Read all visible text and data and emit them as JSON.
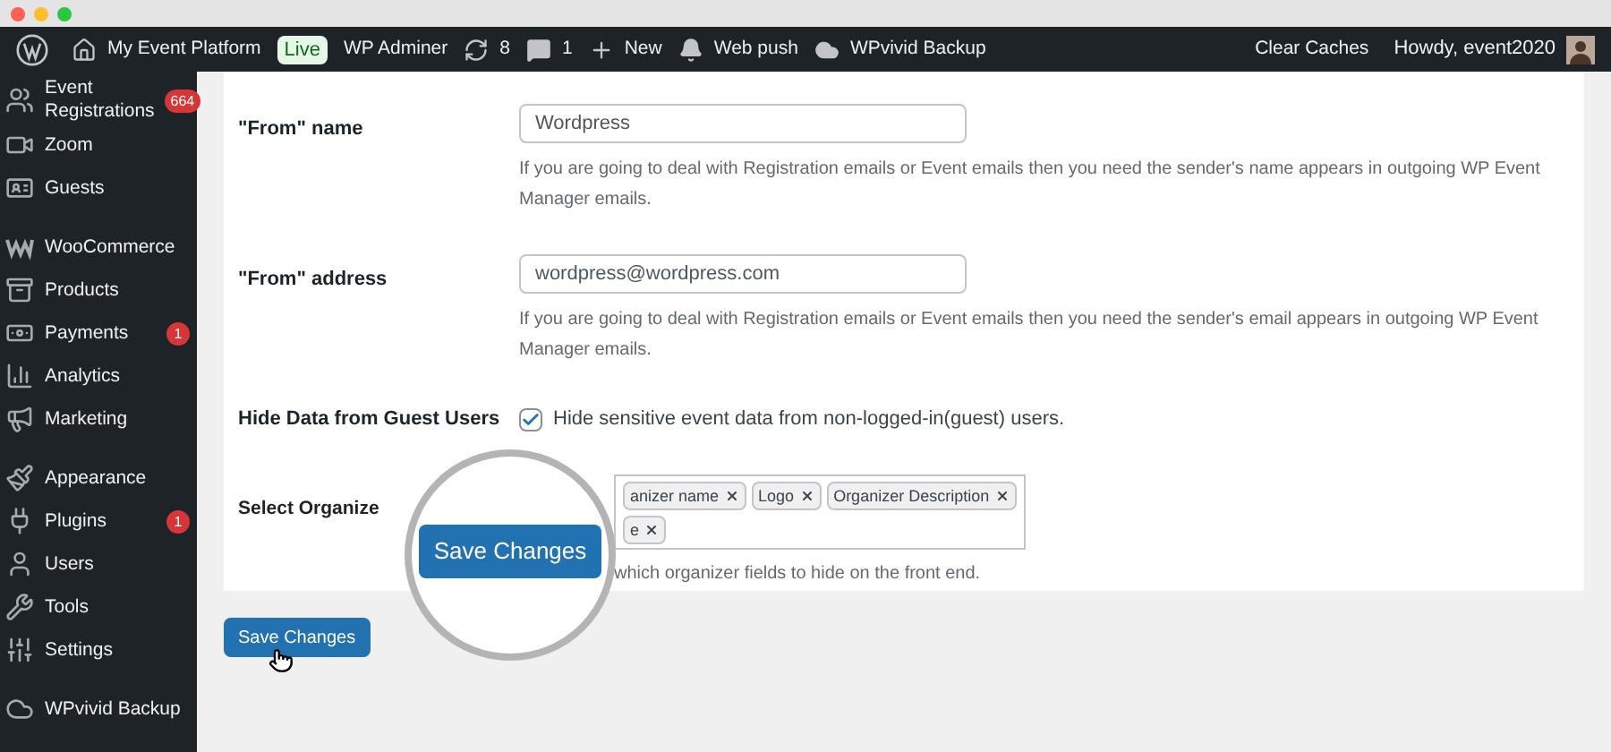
{
  "window_controls": [
    {
      "color": "#ff5f57"
    },
    {
      "color": "#febc2e"
    },
    {
      "color": "#28c840"
    }
  ],
  "admin_bar": {
    "left": [
      {
        "kind": "logo"
      },
      {
        "kind": "site",
        "label": "My Event Platform"
      },
      {
        "kind": "badge",
        "label": "Live"
      },
      {
        "kind": "text",
        "label": "WP Adminer"
      },
      {
        "kind": "updates",
        "label": "8"
      },
      {
        "kind": "comments",
        "label": "1"
      },
      {
        "kind": "new",
        "label": "New"
      },
      {
        "kind": "push",
        "label": "Web push"
      },
      {
        "kind": "backup",
        "label": "WPvivid Backup"
      }
    ],
    "right": [
      {
        "kind": "text",
        "label": "Clear Caches"
      },
      {
        "kind": "account",
        "label": "Howdy, event2020"
      }
    ]
  },
  "sidebar": {
    "groups": [
      [
        {
          "label": "Event Registrations",
          "badge": "664"
        },
        {
          "label": "Zoom"
        },
        {
          "label": "Guests"
        }
      ],
      [
        {
          "label": "WooCommerce"
        },
        {
          "label": "Products"
        },
        {
          "label": "Payments",
          "badge": "1"
        },
        {
          "label": "Analytics"
        },
        {
          "label": "Marketing"
        }
      ],
      [
        {
          "label": "Appearance"
        },
        {
          "label": "Plugins",
          "badge": "1"
        },
        {
          "label": "Users"
        },
        {
          "label": "Tools"
        },
        {
          "label": "Settings"
        }
      ],
      [
        {
          "label": "WPvivid Backup"
        }
      ]
    ]
  },
  "form": [
    {
      "kind": "text",
      "label": "\"From\" name",
      "value": "Wordpress",
      "description": "If you are going to deal with Registration emails or Event emails then you need the sender's name appears in outgoing WP Event Manager emails."
    },
    {
      "kind": "text",
      "label": "\"From\" address",
      "value": "wordpress@wordpress.com",
      "description": "If you are going to deal with Registration emails or Event emails then you need the sender's email appears in outgoing WP Event Manager emails."
    },
    {
      "kind": "checkbox",
      "label": "Hide Data from Guest Users",
      "checked": true,
      "text": "Hide sensitive event data from non-logged-in(guest) users."
    },
    {
      "kind": "tags",
      "label": "Select Organize",
      "tags": [
        [
          "anizer name",
          "Logo",
          "Organizer Description"
        ],
        [
          "e"
        ]
      ],
      "description": "which organizer fields to hide on the front end."
    }
  ],
  "save_button": "Save Changes",
  "magnifier": {
    "button": "Save Changes"
  }
}
